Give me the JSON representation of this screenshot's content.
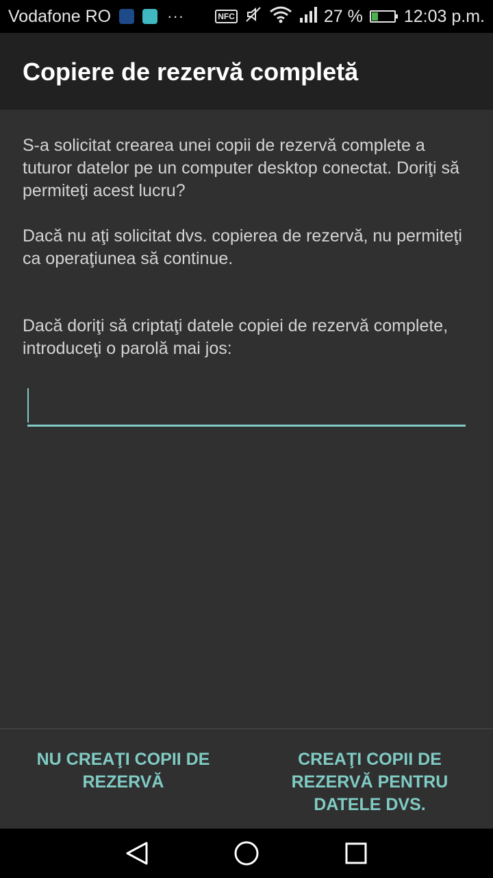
{
  "status_bar": {
    "carrier": "Vodafone RO",
    "more": "···",
    "nfc": "NFC",
    "battery_percent": "27 %",
    "battery_level": 0.27,
    "time": "12:03 p.m."
  },
  "dialog": {
    "title": "Copiere de rezervă completă",
    "paragraph1": "S-a solicitat crearea unei copii de rezervă complete a tuturor datelor pe un computer desktop conectat. Doriţi să permiteţi acest lucru?",
    "paragraph2": "Dacă nu aţi solicitat dvs. copierea de rezervă, nu permiteţi ca operaţiunea să continue.",
    "paragraph3": "Dacă doriţi să criptaţi datele copiei de rezervă complete, introduceţi o parolă mai jos:",
    "password_value": "",
    "deny_button": "NU CREAŢI COPII DE REZERVĂ",
    "allow_button": "CREAŢI COPII DE REZERVĂ PENTRU DATELE DVS."
  },
  "icons": {
    "notification_1": "app-notification-icon",
    "notification_2": "android-notification-icon",
    "mute": "mute-icon",
    "wifi": "wifi-icon",
    "signal": "signal-icon",
    "battery": "battery-charging-icon",
    "back": "back-icon",
    "home": "home-icon",
    "recents": "recents-icon"
  },
  "colors": {
    "accent": "#80cbc4",
    "background": "#303030",
    "title_bar": "#212121"
  }
}
